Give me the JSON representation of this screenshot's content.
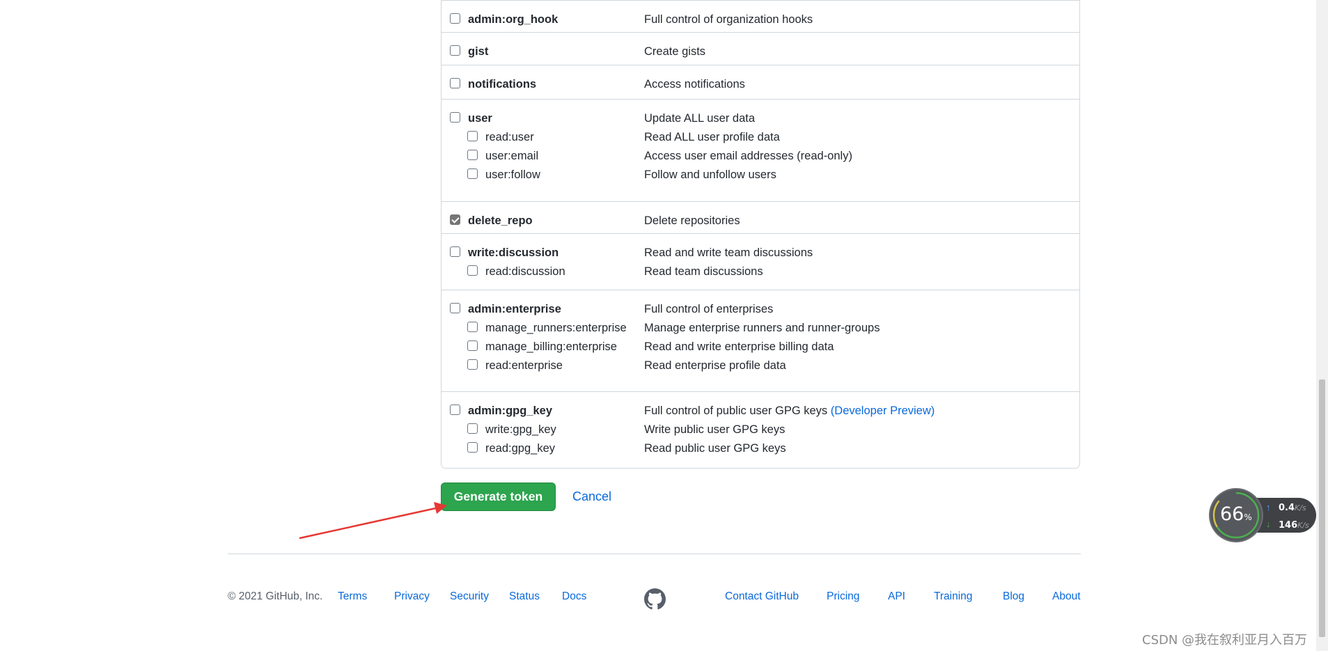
{
  "scopes": [
    {
      "name": "admin:org_hook",
      "desc": "Full control of organization hooks",
      "checked": false,
      "children": []
    },
    {
      "name": "gist",
      "desc": "Create gists",
      "checked": false,
      "children": []
    },
    {
      "name": "notifications",
      "desc": "Access notifications",
      "checked": false,
      "children": []
    },
    {
      "name": "user",
      "desc": "Update ALL user data",
      "checked": false,
      "children": [
        {
          "name": "read:user",
          "desc": "Read ALL user profile data",
          "checked": false
        },
        {
          "name": "user:email",
          "desc": "Access user email addresses (read-only)",
          "checked": false
        },
        {
          "name": "user:follow",
          "desc": "Follow and unfollow users",
          "checked": false
        }
      ]
    },
    {
      "name": "delete_repo",
      "desc": "Delete repositories",
      "checked": true,
      "children": []
    },
    {
      "name": "write:discussion",
      "desc": "Read and write team discussions",
      "checked": false,
      "children": [
        {
          "name": "read:discussion",
          "desc": "Read team discussions",
          "checked": false
        }
      ]
    },
    {
      "name": "admin:enterprise",
      "desc": "Full control of enterprises",
      "checked": false,
      "children": [
        {
          "name": "manage_runners:enterprise",
          "desc": "Manage enterprise runners and runner-groups",
          "checked": false
        },
        {
          "name": "manage_billing:enterprise",
          "desc": "Read and write enterprise billing data",
          "checked": false
        },
        {
          "name": "read:enterprise",
          "desc": "Read enterprise profile data",
          "checked": false
        }
      ]
    },
    {
      "name": "admin:gpg_key",
      "desc": "Full control of public user GPG keys",
      "desc_link": "(Developer Preview)",
      "checked": false,
      "children": [
        {
          "name": "write:gpg_key",
          "desc": "Write public user GPG keys",
          "checked": false
        },
        {
          "name": "read:gpg_key",
          "desc": "Read public user GPG keys",
          "checked": false
        }
      ]
    }
  ],
  "actions": {
    "generate_label": "Generate token",
    "cancel_label": "Cancel"
  },
  "footer": {
    "copyright": "© 2021 GitHub, Inc.",
    "left_links": [
      "Terms",
      "Privacy",
      "Security",
      "Status",
      "Docs"
    ],
    "right_links": [
      "Contact GitHub",
      "Pricing",
      "API",
      "Training",
      "Blog",
      "About"
    ]
  },
  "net_widget": {
    "percent": "66",
    "percent_unit": "%",
    "up": "0.4",
    "down": "146",
    "unit": "K/s"
  },
  "watermark": "CSDN @我在叙利亚月入百万",
  "colors": {
    "primary_button": "#2da44e",
    "link": "#0969da",
    "annotation_arrow": "#e53935"
  },
  "icons": {
    "footer_logo": "github-mark-icon",
    "arrow": "red-annotation-arrow"
  }
}
